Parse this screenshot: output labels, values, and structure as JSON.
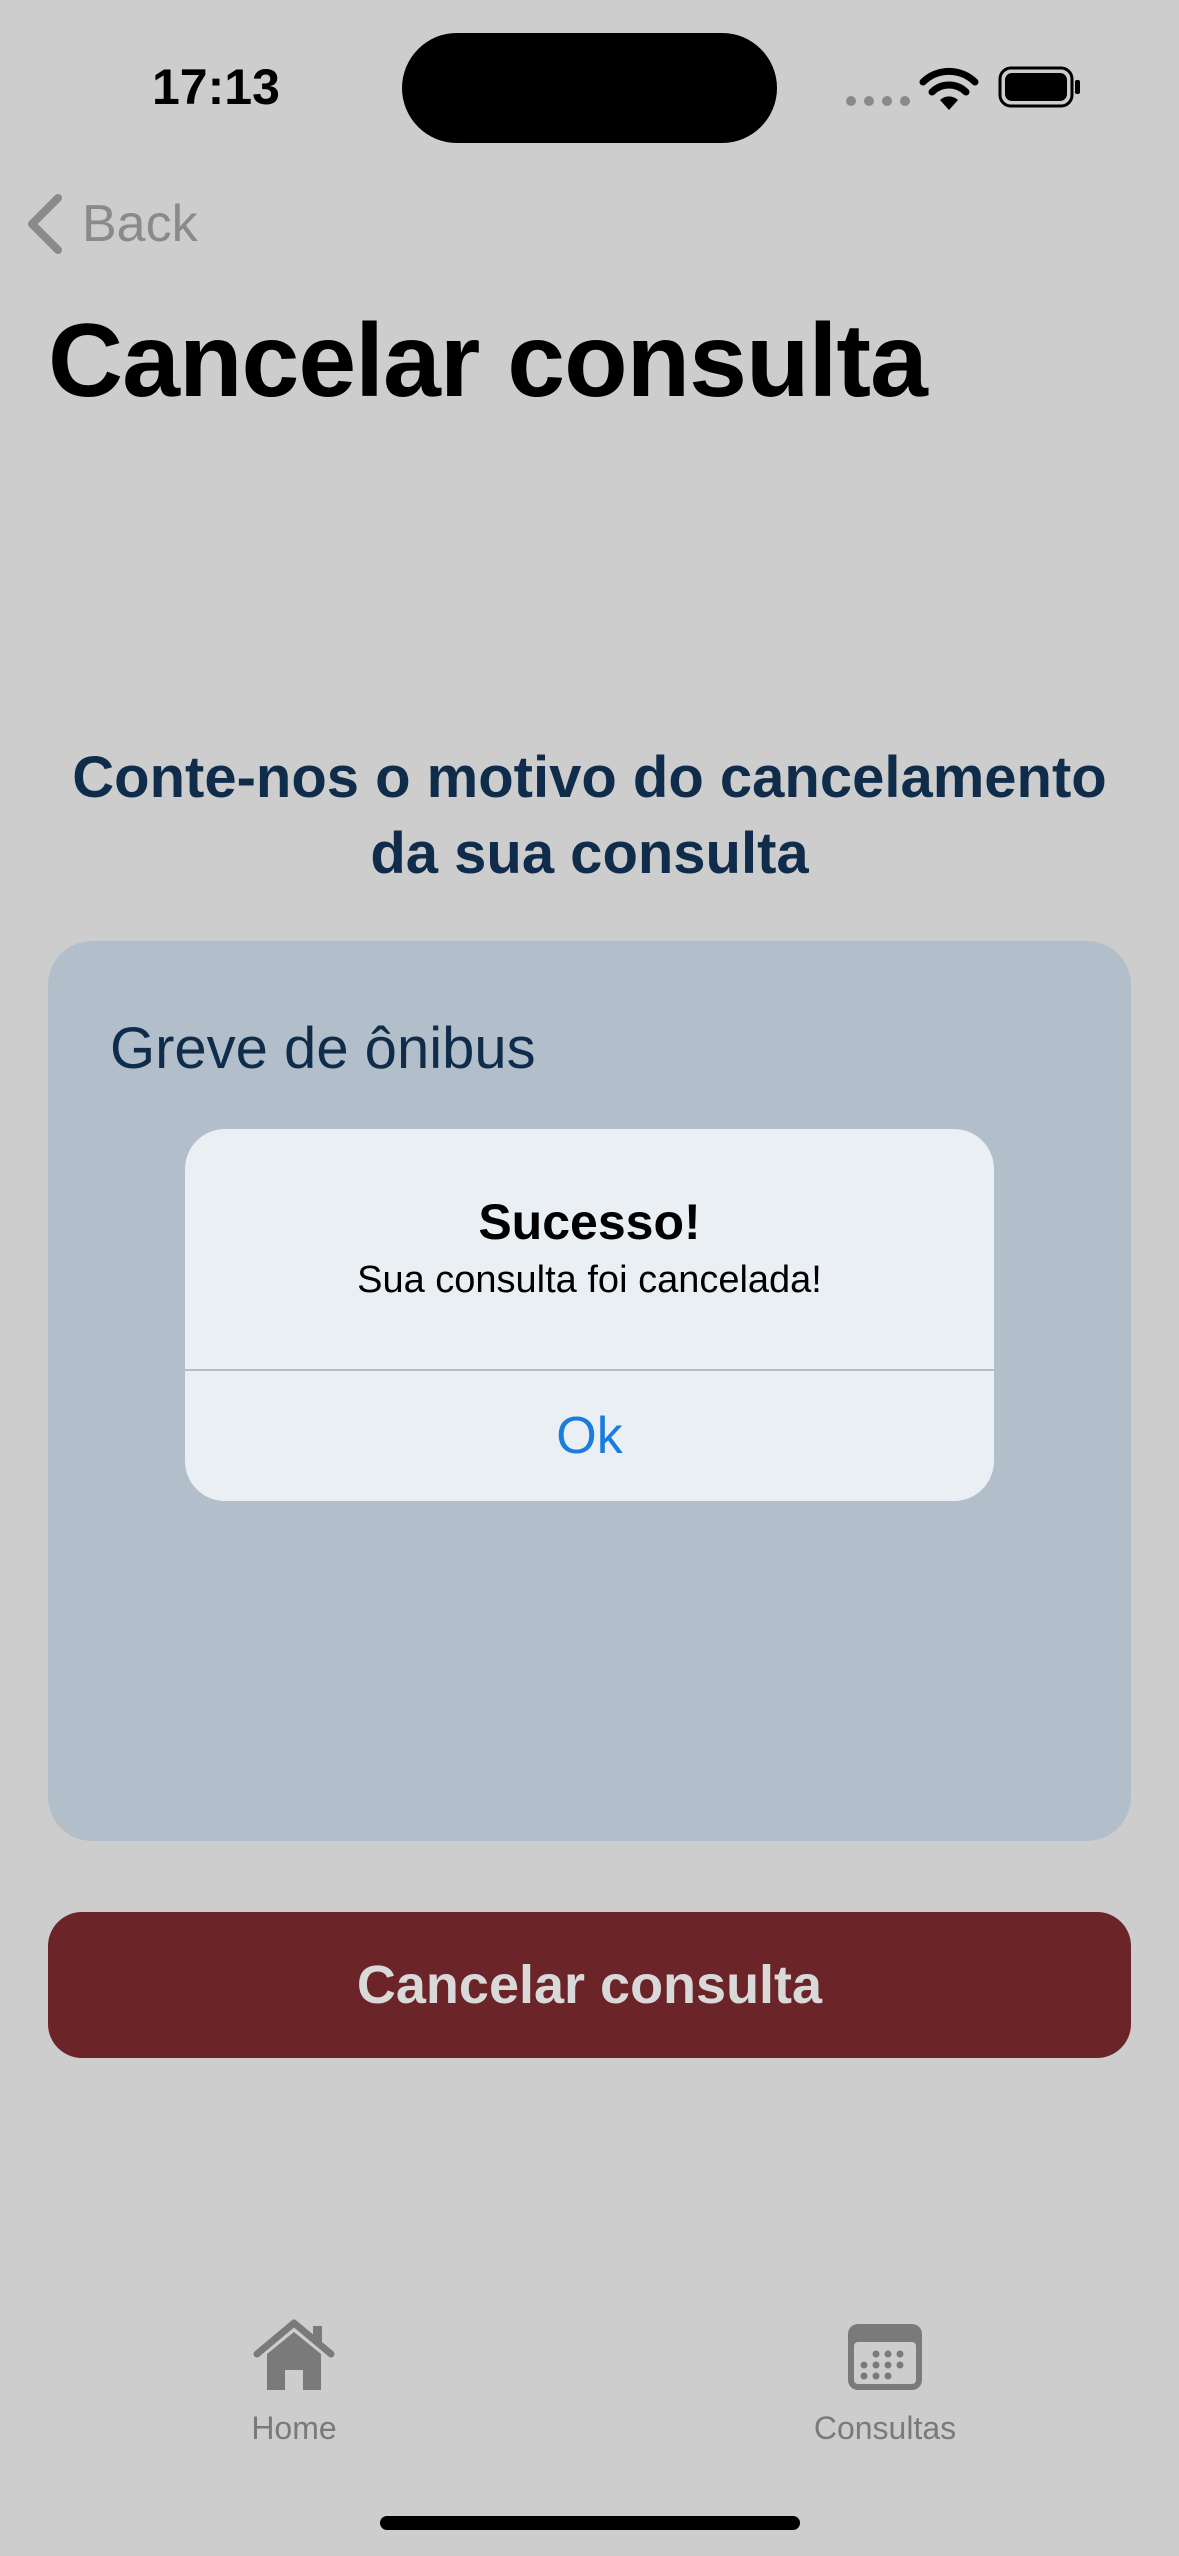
{
  "status_bar": {
    "time": "17:13"
  },
  "nav": {
    "back_label": "Back",
    "title": "Cancelar consulta"
  },
  "prompt": "Conte-nos o motivo do cancelamento da sua consulta",
  "reason_input": {
    "value": "Greve de ônibus"
  },
  "cancel_button": {
    "label": "Cancelar consulta",
    "color": "#6b2428"
  },
  "alert": {
    "title": "Sucesso!",
    "message": "Sua consulta foi cancelada!",
    "ok_label": "Ok",
    "ok_color": "#1a7be0"
  },
  "tab_bar": {
    "items": [
      {
        "label": "Home",
        "icon": "house-icon"
      },
      {
        "label": "Consultas",
        "icon": "calendar-icon"
      }
    ]
  }
}
